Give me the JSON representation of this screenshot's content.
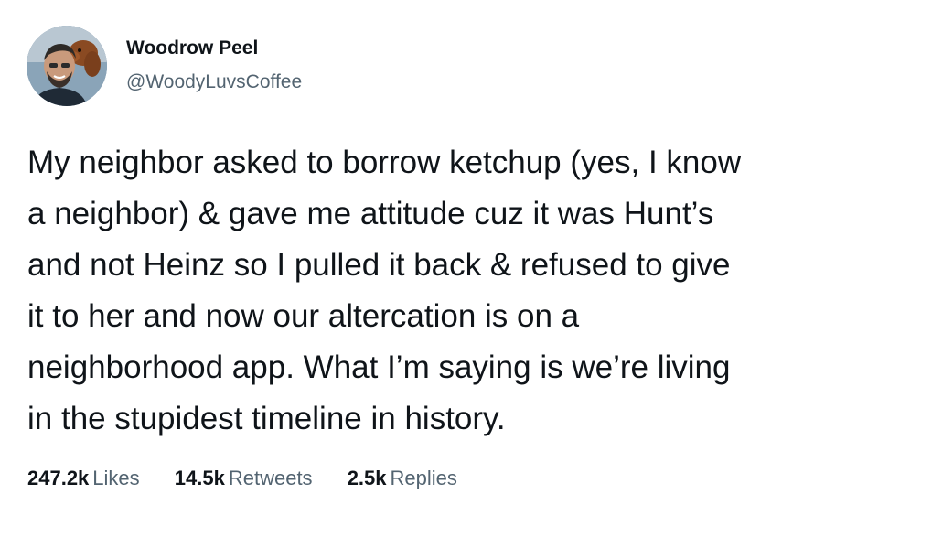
{
  "user": {
    "display_name": "Woodrow Peel",
    "handle": "@WoodyLuvsCoffee",
    "avatar_icon": "profile-photo-man-with-dog"
  },
  "tweet": {
    "lines": [
      "My neighbor asked to borrow ketchup (yes, I know",
      "a neighbor) & gave me attitude cuz it was Hunt’s",
      "and not Heinz so I pulled it back & refused to give",
      "it to her and now our altercation is on a",
      "neighborhood app. What I’m saying is we’re living",
      "in the stupidest timeline in history."
    ]
  },
  "stats": {
    "likes_count": "247.2k",
    "likes_label": "Likes",
    "retweets_count": "14.5k",
    "retweets_label": "Retweets",
    "replies_count": "2.5k",
    "replies_label": "Replies"
  },
  "colors": {
    "text_primary": "#0f1419",
    "text_secondary": "#536471",
    "background": "#ffffff"
  }
}
